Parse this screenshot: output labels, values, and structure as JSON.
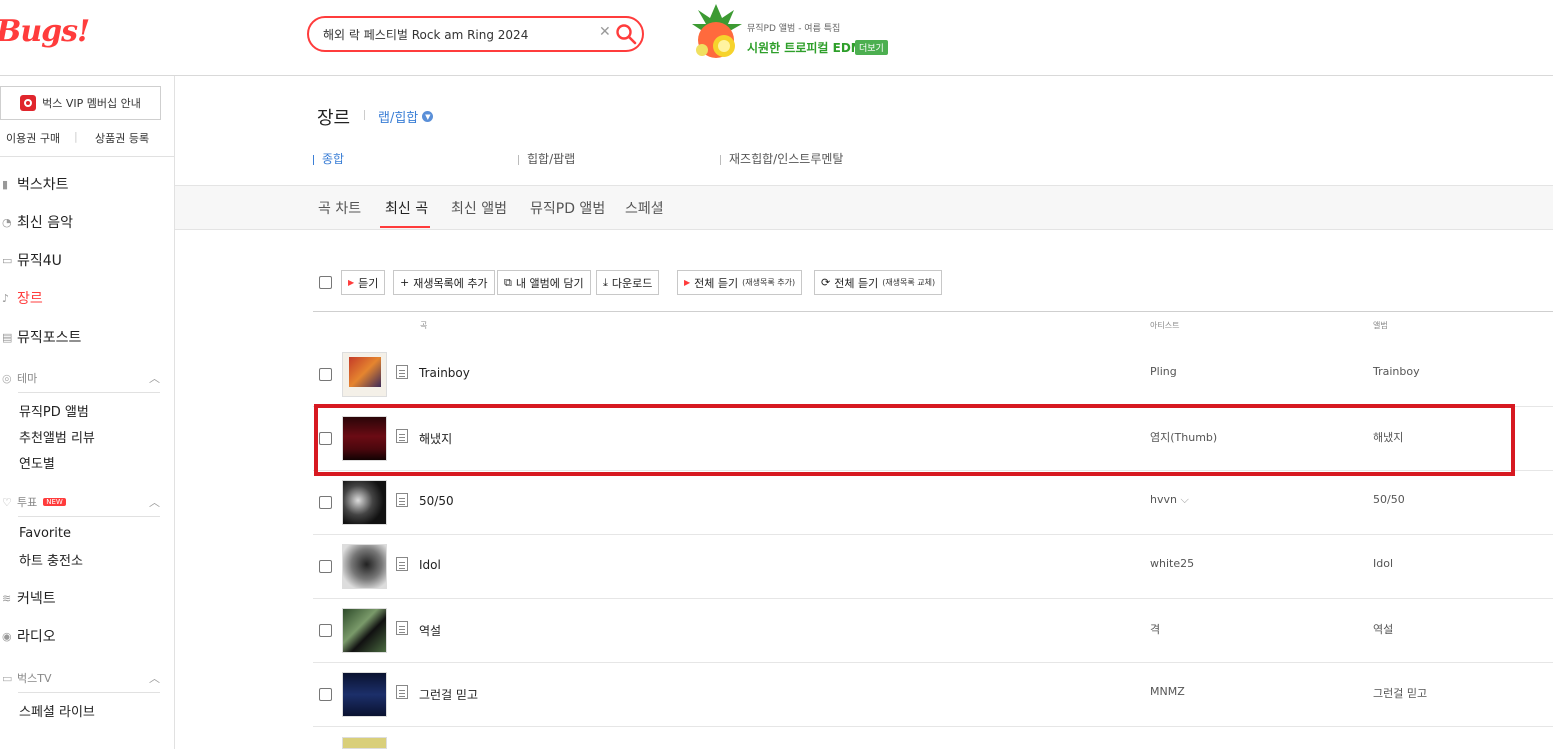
{
  "header": {
    "logo": "Bugs!",
    "search": {
      "value": "해외 락 페스티벌 Rock am Ring 2024",
      "clear_glyph": "✕"
    },
    "promo": {
      "top": "뮤직PD 앨범 - 여름 특집",
      "main": "시원한 트로피컬 EDM",
      "more": "더보기"
    }
  },
  "sidebar": {
    "vip": "벅스 VIP 멤버십 안내",
    "buy": "이용권 구매",
    "coupon": "상품권 등록",
    "menu": [
      "벅스차트",
      "최신 음악",
      "뮤직4U",
      "장르",
      "뮤직포스트"
    ],
    "theme": {
      "label": "테마",
      "items": [
        "뮤직PD 앨범",
        "추천앨범 리뷰",
        "연도별"
      ]
    },
    "vote": {
      "label": "투표",
      "badge": "NEW",
      "items": [
        "Favorite",
        "하트 충전소"
      ]
    },
    "menu2": [
      "커넥트",
      "라디오"
    ],
    "tv": {
      "label": "벅스TV",
      "items": [
        "스페셜 라이브"
      ]
    }
  },
  "main": {
    "title": "장르",
    "genre": "랩/힙합",
    "subgenres": [
      "종합",
      "힙합/팝랩",
      "재즈힙합/인스트루멘탈"
    ],
    "tabs": [
      "곡 차트",
      "최신 곡",
      "최신 앨범",
      "뮤직PD 앨범",
      "스페셜"
    ],
    "toolbar": {
      "listen": "듣기",
      "add_playlist": "재생목록에 추가",
      "my_album": "내 앨범에 담기",
      "download": "다운로드",
      "all_add": "전체 듣기",
      "all_add_small": "(재생목록 추가)",
      "all_replace": "전체 듣기",
      "all_replace_small": "(재생목록 교체)"
    },
    "columns": {
      "song": "곡",
      "artist": "아티스트",
      "album": "앨범"
    },
    "rows": [
      {
        "title": "Trainboy",
        "artist": "Pling",
        "album": "Trainboy"
      },
      {
        "title": "해냈지",
        "artist": "염지(Thumb)",
        "album": "해냈지"
      },
      {
        "title": "50/50",
        "artist": "hvvn",
        "album": "50/50"
      },
      {
        "title": "Idol",
        "artist": "white25",
        "album": "Idol"
      },
      {
        "title": "역설",
        "artist": "격",
        "album": "역설"
      },
      {
        "title": "그런걸 믿고",
        "artist": "MNMZ",
        "album": "그런걸 믿고"
      }
    ]
  },
  "colors": {
    "accent": "#ff3c3c",
    "link": "#3c7fd6",
    "highlight": "#d71921"
  }
}
